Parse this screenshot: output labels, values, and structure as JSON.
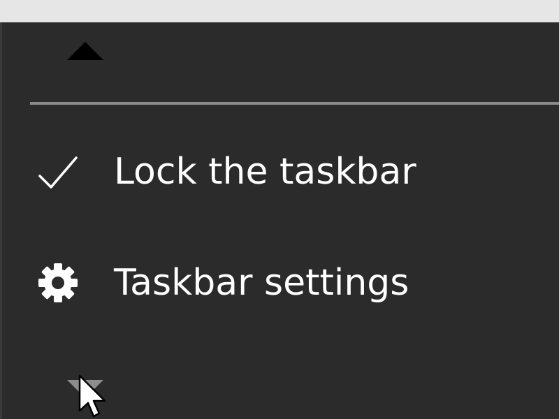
{
  "menu": {
    "items": [
      {
        "label": "Lock the taskbar",
        "icon": "checkmark-icon",
        "checked": true
      },
      {
        "label": "Taskbar settings",
        "icon": "gear-icon"
      }
    ],
    "scroll_up_icon": "scroll-up-arrow-icon",
    "scroll_down_icon": "scroll-down-arrow-icon"
  },
  "colors": {
    "menu_background": "#2b2b2b",
    "separator": "#8a8a8a",
    "text": "#ffffff",
    "top_strip": "#e6e6e6"
  },
  "cursor": {
    "icon": "mouse-pointer-icon"
  }
}
